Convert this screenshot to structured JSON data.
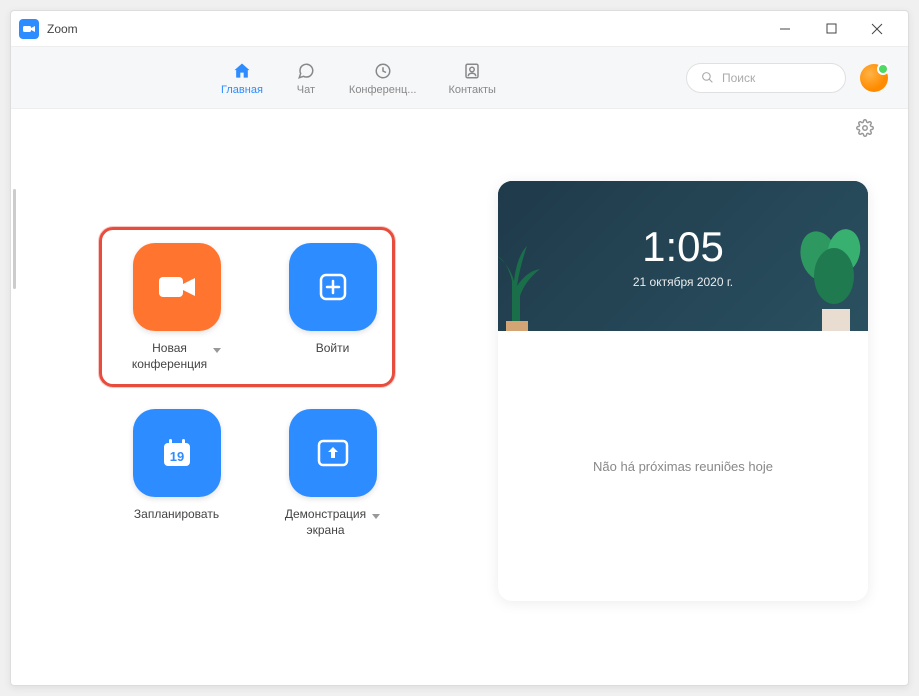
{
  "window": {
    "title": "Zoom"
  },
  "tabs": {
    "home": "Главная",
    "chat": "Чат",
    "meetings": "Конференц...",
    "contacts": "Контакты"
  },
  "search": {
    "placeholder": "Поиск"
  },
  "actions": {
    "new_meeting": "Новая\nконференция",
    "join": "Войти",
    "schedule": "Запланировать",
    "schedule_day": "19",
    "share_screen": "Демонстрация\nэкрана"
  },
  "clock": {
    "time": "1:05",
    "date": "21 октября 2020 г."
  },
  "meetings": {
    "empty_text": "Não há próximas reuniões hoje"
  },
  "colors": {
    "primary_blue": "#2D8CFF",
    "accent_orange": "#FF742E",
    "highlight_red": "#e74c3c"
  }
}
